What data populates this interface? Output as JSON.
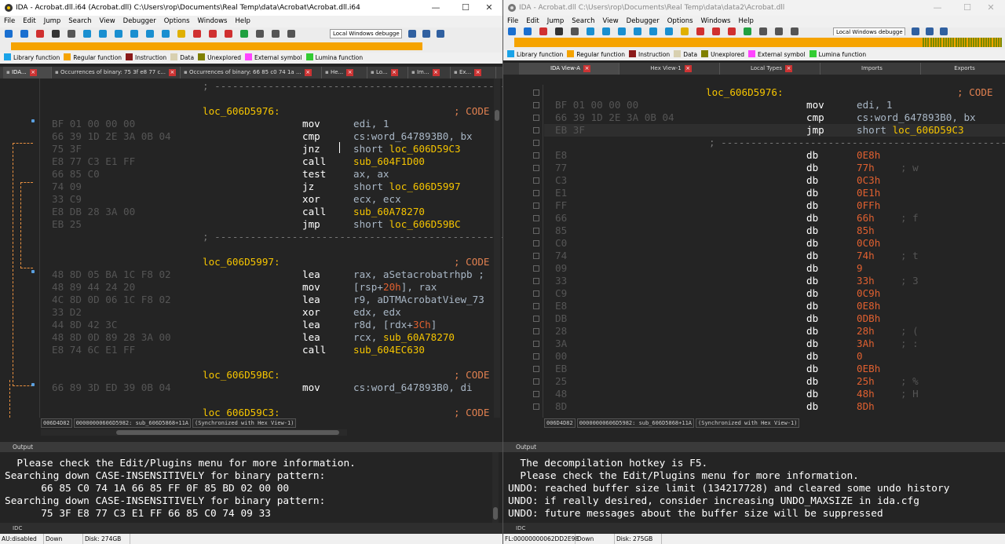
{
  "left": {
    "title": "IDA - Acrobat.dll.i64 (Acrobat.dll) C:\\Users\\rop\\Documents\\Real Temp\\data\\Acrobat\\Acrobat.dll.i64",
    "window_controls": [
      "—",
      "☐",
      "✕"
    ],
    "menu": [
      "File",
      "Edit",
      "Jump",
      "Search",
      "View",
      "Debugger",
      "Options",
      "Windows",
      "Help"
    ],
    "debugger": "Local Windows debugge",
    "legend": [
      {
        "label": "Library function",
        "color": "#1aa3e8"
      },
      {
        "label": "Regular function",
        "color": "#f5a300"
      },
      {
        "label": "Instruction",
        "color": "#8b1a1a"
      },
      {
        "label": "Data",
        "color": "#d8d0b0"
      },
      {
        "label": "Unexplored",
        "color": "#808000"
      },
      {
        "label": "External symbol",
        "color": "#ff44ff"
      },
      {
        "label": "Lumina function",
        "color": "#33cc33"
      }
    ],
    "tabs": [
      {
        "label": "IDA...",
        "active": true
      },
      {
        "label": "Occurrences of binary: 75 3f e8 77 c...",
        "active": false
      },
      {
        "label": "Occurrences of binary: 66 85 c0 74 1a ...",
        "active": false
      },
      {
        "label": "He...",
        "active": false
      },
      {
        "label": "Lo...",
        "active": false
      },
      {
        "label": "Im...",
        "active": false
      },
      {
        "label": "Ex...",
        "active": false
      }
    ],
    "code": [
      {
        "addr": "",
        "bytes": "",
        "label": "",
        "mn": "",
        "op": "",
        "sep": "; ---------------------------------------------------------------------------"
      },
      {
        "addr": "",
        "bytes": "",
        "label": "",
        "mn": "",
        "op": "",
        "sep": ""
      },
      {
        "addr": "",
        "bytes": "",
        "label": "loc_606D5976:",
        "mn": "",
        "op": "",
        "cmt": "; CODE"
      },
      {
        "addr": "",
        "bytes": "BF 01 00 00 00",
        "mn": "mov",
        "op": "edi, 1"
      },
      {
        "addr": "",
        "bytes": "66 39 1D 2E 3A 0B 04",
        "mn": "cmp",
        "op": "cs:word_647893B0, bx"
      },
      {
        "addr": "",
        "bytes": "75 3F",
        "mn": "jnz",
        "op": "short ",
        "opy": "loc_606D59C3"
      },
      {
        "addr": "",
        "bytes": "E8 77 C3 E1 FF",
        "mn": "call",
        "op": "",
        "opy": "sub_604F1D00"
      },
      {
        "addr": "",
        "bytes": "66 85 C0",
        "mn": "test",
        "op": "ax, ax"
      },
      {
        "addr": "",
        "bytes": "74 09",
        "mn": "jz",
        "op": "short ",
        "opy": "loc_606D5997"
      },
      {
        "addr": "",
        "bytes": "33 C9",
        "mn": "xor",
        "op": "ecx, ecx"
      },
      {
        "addr": "",
        "bytes": "E8 DB 28 3A 00",
        "mn": "call",
        "op": "",
        "opy": "sub_60A78270"
      },
      {
        "addr": "",
        "bytes": "EB 25",
        "mn": "jmp",
        "op": "short ",
        "opy": "loc_606D59BC"
      },
      {
        "addr": "",
        "bytes": "",
        "label": "",
        "mn": "",
        "op": "",
        "sep": "; ---------------------------------------------------------------------------"
      },
      {
        "addr": "",
        "bytes": "",
        "label": "",
        "mn": "",
        "op": "",
        "sep": ""
      },
      {
        "addr": "",
        "bytes": "",
        "label": "loc_606D5997:",
        "mn": "",
        "op": "",
        "cmt": "; CODE"
      },
      {
        "addr": "",
        "bytes": "48 8D 05 BA 1C F8 02",
        "mn": "lea",
        "op": "rax, aSetacrobatrhpb ;"
      },
      {
        "addr": "",
        "bytes": "48 89 44 24 20",
        "mn": "mov",
        "op": "[rsp+",
        "opr": "20h",
        "op2": "], rax"
      },
      {
        "addr": "",
        "bytes": "4C 8D 0D 06 1C F8 02",
        "mn": "lea",
        "op": "r9, aDTMAcrobatView_73"
      },
      {
        "addr": "",
        "bytes": "33 D2",
        "mn": "xor",
        "op": "edx, edx"
      },
      {
        "addr": "",
        "bytes": "44 8D 42 3C",
        "mn": "lea",
        "op": "r8d, [rdx+",
        "opr": "3Ch",
        "op2": "]"
      },
      {
        "addr": "",
        "bytes": "48 8D 0D 89 28 3A 00",
        "mn": "lea",
        "op": "rcx, ",
        "opy": "sub_60A78270"
      },
      {
        "addr": "",
        "bytes": "E8 74 6C E1 FF",
        "mn": "call",
        "op": "",
        "opy": "sub_604EC630"
      },
      {
        "addr": "",
        "bytes": "",
        "label": "",
        "mn": "",
        "op": "",
        "sep": ""
      },
      {
        "addr": "",
        "bytes": "",
        "label": "loc_606D59BC:",
        "mn": "",
        "op": "",
        "cmt": "; CODE"
      },
      {
        "addr": "",
        "bytes": "66 89 3D ED 39 0B 04",
        "mn": "mov",
        "op": "cs:word_647893B0, di"
      },
      {
        "addr": "",
        "bytes": "",
        "label": "",
        "mn": "",
        "op": "",
        "sep": ""
      },
      {
        "addr": "",
        "bytes": "",
        "label": "loc_606D59C3:",
        "mn": "",
        "op": "",
        "cmt": "; CODE"
      }
    ],
    "status_fields": [
      "006D4D82",
      "00000000606D5982: sub_606D5868+11A",
      "(Synchronized with Hex View-1)"
    ],
    "output_title": "Output",
    "output": [
      "  Please check the Edit/Plugins menu for more information.",
      "Searching down CASE-INSENSITIVELY for binary pattern:",
      "      66 85 C0 74 1A 66 85 FF 0F 85 BD 02 00 00",
      "Searching down CASE-INSENSITIVELY for binary pattern:",
      "      75 3F E8 77 C3 E1 FF 66 85 C0 74 09 33"
    ],
    "idc": "IDC",
    "statusbar": [
      "AU:disabled",
      "Down",
      "Disk: 274GB"
    ]
  },
  "right": {
    "title": "IDA - Acrobat.dll C:\\Users\\rop\\Documents\\Real Temp\\data\\data2\\Acrobat.dll",
    "window_controls": [
      "—",
      "☐",
      "✕"
    ],
    "menu": [
      "File",
      "Edit",
      "Jump",
      "Search",
      "View",
      "Debugger",
      "Options",
      "Windows",
      "Help"
    ],
    "debugger": "Local Windows debugge",
    "legend": [
      {
        "label": "Library function",
        "color": "#1aa3e8"
      },
      {
        "label": "Regular function",
        "color": "#f5a300"
      },
      {
        "label": "Instruction",
        "color": "#8b1a1a"
      },
      {
        "label": "Data",
        "color": "#d8d0b0"
      },
      {
        "label": "Unexplored",
        "color": "#808000"
      },
      {
        "label": "External symbol",
        "color": "#ff44ff"
      },
      {
        "label": "Lumina function",
        "color": "#33cc33"
      }
    ],
    "tabs": [
      {
        "label": "IDA View-A",
        "active": true
      },
      {
        "label": "Hex View-1",
        "active": false
      },
      {
        "label": "Local Types",
        "active": false
      },
      {
        "label": "Imports",
        "active": false
      },
      {
        "label": "Exports",
        "active": false
      }
    ],
    "code": [
      {
        "label": "loc_606D5976:",
        "cmt": "; CODE"
      },
      {
        "bytes": "BF 01 00 00 00",
        "mn": "mov",
        "op": "edi, 1"
      },
      {
        "bytes": "66 39 1D 2E 3A 0B 04",
        "mn": "cmp",
        "op": "cs:word_647893B0, bx"
      },
      {
        "bytes": "EB 3F",
        "mn": "jmp",
        "op": "short ",
        "opy": "loc_606D59C3"
      },
      {
        "sep": "; ---------------------------------------------------------------------------"
      },
      {
        "bytes": "E8",
        "mn": "db",
        "opr": "0E8h"
      },
      {
        "bytes": "77",
        "mn": "db",
        "opr": "77h",
        "c2": "; w"
      },
      {
        "bytes": "C3",
        "mn": "db",
        "opr": "0C3h"
      },
      {
        "bytes": "E1",
        "mn": "db",
        "opr": "0E1h"
      },
      {
        "bytes": "FF",
        "mn": "db",
        "opr": "0FFh"
      },
      {
        "bytes": "66",
        "mn": "db",
        "opr": "66h",
        "c2": "; f"
      },
      {
        "bytes": "85",
        "mn": "db",
        "opr": "85h"
      },
      {
        "bytes": "C0",
        "mn": "db",
        "opr": "0C0h"
      },
      {
        "bytes": "74",
        "mn": "db",
        "opr": "74h",
        "c2": "; t"
      },
      {
        "bytes": "09",
        "mn": "db",
        "opr": "9"
      },
      {
        "bytes": "33",
        "mn": "db",
        "opr": "33h",
        "c2": "; 3"
      },
      {
        "bytes": "C9",
        "mn": "db",
        "opr": "0C9h"
      },
      {
        "bytes": "E8",
        "mn": "db",
        "opr": "0E8h"
      },
      {
        "bytes": "DB",
        "mn": "db",
        "opr": "0DBh"
      },
      {
        "bytes": "28",
        "mn": "db",
        "opr": "28h",
        "c2": "; ("
      },
      {
        "bytes": "3A",
        "mn": "db",
        "opr": "3Ah",
        "c2": "; :"
      },
      {
        "bytes": "00",
        "mn": "db",
        "opr": "0"
      },
      {
        "bytes": "EB",
        "mn": "db",
        "opr": "0EBh"
      },
      {
        "bytes": "25",
        "mn": "db",
        "opr": "25h",
        "c2": "; %"
      },
      {
        "bytes": "48",
        "mn": "db",
        "opr": "48h",
        "c2": "; H"
      },
      {
        "bytes": "8D",
        "mn": "db",
        "opr": "8Dh"
      }
    ],
    "status_fields": [
      "006D4D82",
      "00000000606D5982: sub_606D5868+11A",
      "(Synchronized with Hex View-1)"
    ],
    "output_title": "Output",
    "output": [
      "  The decompilation hotkey is F5.",
      "  Please check the Edit/Plugins menu for more information.",
      "UNDO: reached buffer size limit (134217728) and cleared some undo history",
      "UNDO: if really desired, consider increasing UNDO_MAXSIZE in ida.cfg",
      "UNDO: future messages about the buffer size will be suppressed"
    ],
    "idc": "IDC",
    "statusbar": [
      "FL:00000000062DD2E98",
      "Down",
      "Disk: 275GB"
    ]
  }
}
